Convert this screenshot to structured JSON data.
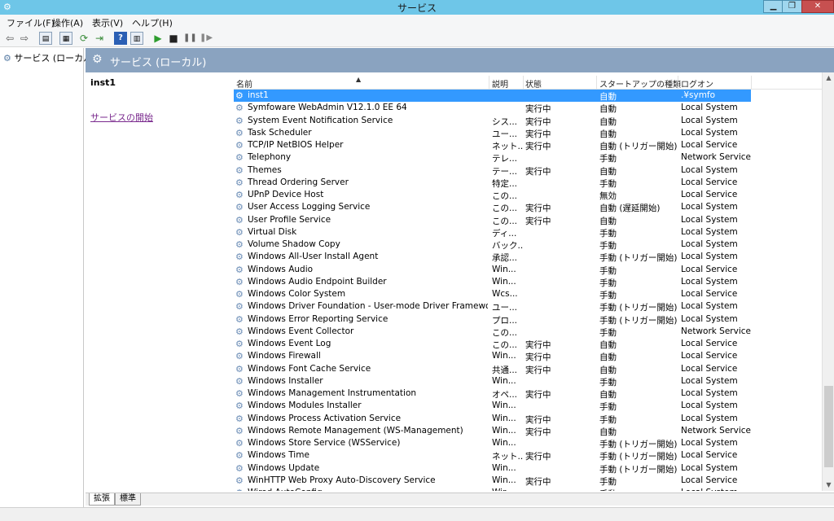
{
  "window": {
    "title": "サービス"
  },
  "menu": [
    "ファイル(F)",
    "操作(A)",
    "表示(V)",
    "ヘルプ(H)"
  ],
  "tree": {
    "root": "サービス (ローカル)"
  },
  "header": {
    "title": "サービス (ローカル)"
  },
  "details": {
    "selected_name": "inst1",
    "start_link": "サービスの開始"
  },
  "columns": {
    "name": "名前",
    "description": "説明",
    "status": "状態",
    "startup": "スタートアップの種類",
    "logon": "ログオン"
  },
  "services": [
    {
      "name": "inst1",
      "desc": "",
      "status": "",
      "startup": "自動",
      "logon": ".¥symfo"
    },
    {
      "name": "Symfoware WebAdmin V12.1.0 EE 64",
      "desc": "",
      "status": "実行中",
      "startup": "自動",
      "logon": "Local System"
    },
    {
      "name": "System Event Notification Service",
      "desc": "シス...",
      "status": "実行中",
      "startup": "自動",
      "logon": "Local System"
    },
    {
      "name": "Task Scheduler",
      "desc": "ユー...",
      "status": "実行中",
      "startup": "自動",
      "logon": "Local System"
    },
    {
      "name": "TCP/IP NetBIOS Helper",
      "desc": "ネット...",
      "status": "実行中",
      "startup": "自動 (トリガー開始)",
      "logon": "Local Service"
    },
    {
      "name": "Telephony",
      "desc": "テレ...",
      "status": "",
      "startup": "手動",
      "logon": "Network Service"
    },
    {
      "name": "Themes",
      "desc": "テー...",
      "status": "実行中",
      "startup": "自動",
      "logon": "Local System"
    },
    {
      "name": "Thread Ordering Server",
      "desc": "特定...",
      "status": "",
      "startup": "手動",
      "logon": "Local Service"
    },
    {
      "name": "UPnP Device Host",
      "desc": "この...",
      "status": "",
      "startup": "無効",
      "logon": "Local Service"
    },
    {
      "name": "User Access Logging Service",
      "desc": "この...",
      "status": "実行中",
      "startup": "自動 (遅延開始)",
      "logon": "Local System"
    },
    {
      "name": "User Profile Service",
      "desc": "この...",
      "status": "実行中",
      "startup": "自動",
      "logon": "Local System"
    },
    {
      "name": "Virtual Disk",
      "desc": "ディ...",
      "status": "",
      "startup": "手動",
      "logon": "Local System"
    },
    {
      "name": "Volume Shadow Copy",
      "desc": "バック...",
      "status": "",
      "startup": "手動",
      "logon": "Local System"
    },
    {
      "name": "Windows All-User Install Agent",
      "desc": "承認...",
      "status": "",
      "startup": "手動 (トリガー開始)",
      "logon": "Local System"
    },
    {
      "name": "Windows Audio",
      "desc": "Win...",
      "status": "",
      "startup": "手動",
      "logon": "Local Service"
    },
    {
      "name": "Windows Audio Endpoint Builder",
      "desc": "Win...",
      "status": "",
      "startup": "手動",
      "logon": "Local System"
    },
    {
      "name": "Windows Color System",
      "desc": "Wcs...",
      "status": "",
      "startup": "手動",
      "logon": "Local Service"
    },
    {
      "name": "Windows Driver Foundation - User-mode Driver Framework",
      "desc": "ユー...",
      "status": "",
      "startup": "手動 (トリガー開始)",
      "logon": "Local System"
    },
    {
      "name": "Windows Error Reporting Service",
      "desc": "プロ...",
      "status": "",
      "startup": "手動 (トリガー開始)",
      "logon": "Local System"
    },
    {
      "name": "Windows Event Collector",
      "desc": "この...",
      "status": "",
      "startup": "手動",
      "logon": "Network Service"
    },
    {
      "name": "Windows Event Log",
      "desc": "この...",
      "status": "実行中",
      "startup": "自動",
      "logon": "Local Service"
    },
    {
      "name": "Windows Firewall",
      "desc": "Win...",
      "status": "実行中",
      "startup": "自動",
      "logon": "Local Service"
    },
    {
      "name": "Windows Font Cache Service",
      "desc": "共通...",
      "status": "実行中",
      "startup": "自動",
      "logon": "Local Service"
    },
    {
      "name": "Windows Installer",
      "desc": "Win...",
      "status": "",
      "startup": "手動",
      "logon": "Local System"
    },
    {
      "name": "Windows Management Instrumentation",
      "desc": "オペ...",
      "status": "実行中",
      "startup": "自動",
      "logon": "Local System"
    },
    {
      "name": "Windows Modules Installer",
      "desc": "Win...",
      "status": "",
      "startup": "手動",
      "logon": "Local System"
    },
    {
      "name": "Windows Process Activation Service",
      "desc": "Win...",
      "status": "実行中",
      "startup": "手動",
      "logon": "Local System"
    },
    {
      "name": "Windows Remote Management (WS-Management)",
      "desc": "Win...",
      "status": "実行中",
      "startup": "自動",
      "logon": "Network Service"
    },
    {
      "name": "Windows Store Service (WSService)",
      "desc": "Win...",
      "status": "",
      "startup": "手動 (トリガー開始)",
      "logon": "Local System"
    },
    {
      "name": "Windows Time",
      "desc": "ネット...",
      "status": "実行中",
      "startup": "手動 (トリガー開始)",
      "logon": "Local Service"
    },
    {
      "name": "Windows Update",
      "desc": "Win...",
      "status": "",
      "startup": "手動 (トリガー開始)",
      "logon": "Local System"
    },
    {
      "name": "WinHTTP Web Proxy Auto-Discovery Service",
      "desc": "Win...",
      "status": "実行中",
      "startup": "手動",
      "logon": "Local Service"
    },
    {
      "name": "Wired AutoConfig",
      "desc": "Wir...",
      "status": "",
      "startup": "手動",
      "logon": "Local System"
    }
  ],
  "tabs": [
    "拡張",
    "標準"
  ],
  "selected_index": 0
}
